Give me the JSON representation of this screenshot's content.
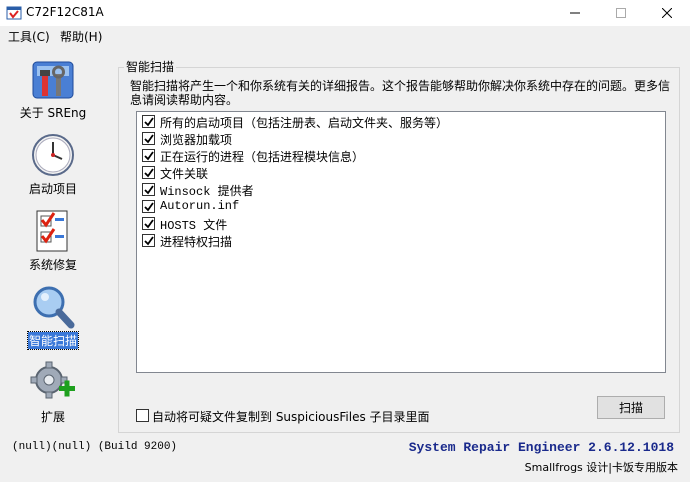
{
  "window": {
    "title": "C72F12C81A"
  },
  "menu": [
    {
      "label": "工具(C)"
    },
    {
      "label": "帮助(H)"
    }
  ],
  "sidebar": {
    "items": [
      {
        "label": "关于 SREng",
        "icon": "toolbox-icon"
      },
      {
        "label": "启动项目",
        "icon": "clock-icon"
      },
      {
        "label": "系统修复",
        "icon": "checklist-icon"
      },
      {
        "label": "智能扫描",
        "icon": "magnifier-icon",
        "active": true
      },
      {
        "label": "扩展",
        "icon": "gear-plus-icon"
      }
    ]
  },
  "main": {
    "group_title": "智能扫描",
    "description": "智能扫描将产生一个和你系统有关的详细报告。这个报告能够帮助你解决你系统中存在的问题。更多信息请阅读帮助内容。",
    "scan_items": [
      {
        "label": "所有的启动项目（包括注册表、启动文件夹、服务等）",
        "checked": true
      },
      {
        "label": "浏览器加载项",
        "checked": true
      },
      {
        "label": "正在运行的进程（包括进程模块信息）",
        "checked": true
      },
      {
        "label": "文件关联",
        "checked": true
      },
      {
        "label": "Winsock 提供者",
        "checked": true
      },
      {
        "label": "Autorun.inf",
        "checked": true
      },
      {
        "label": "HOSTS 文件",
        "checked": true
      },
      {
        "label": "进程特权扫描",
        "checked": true
      }
    ],
    "copy_option": {
      "label": "自动将可疑文件复制到 SuspiciousFiles 子目录里面",
      "checked": false
    },
    "scan_button": "扫描"
  },
  "status": {
    "left": "(null)(null) (Build 9200)",
    "product": "System Repair Engineer 2.6.12.1018",
    "credit": "Smallfrogs 设计|卡饭专用版本"
  },
  "colors": {
    "accent": "#3a78d8",
    "product_text": "#1a2a8c"
  }
}
